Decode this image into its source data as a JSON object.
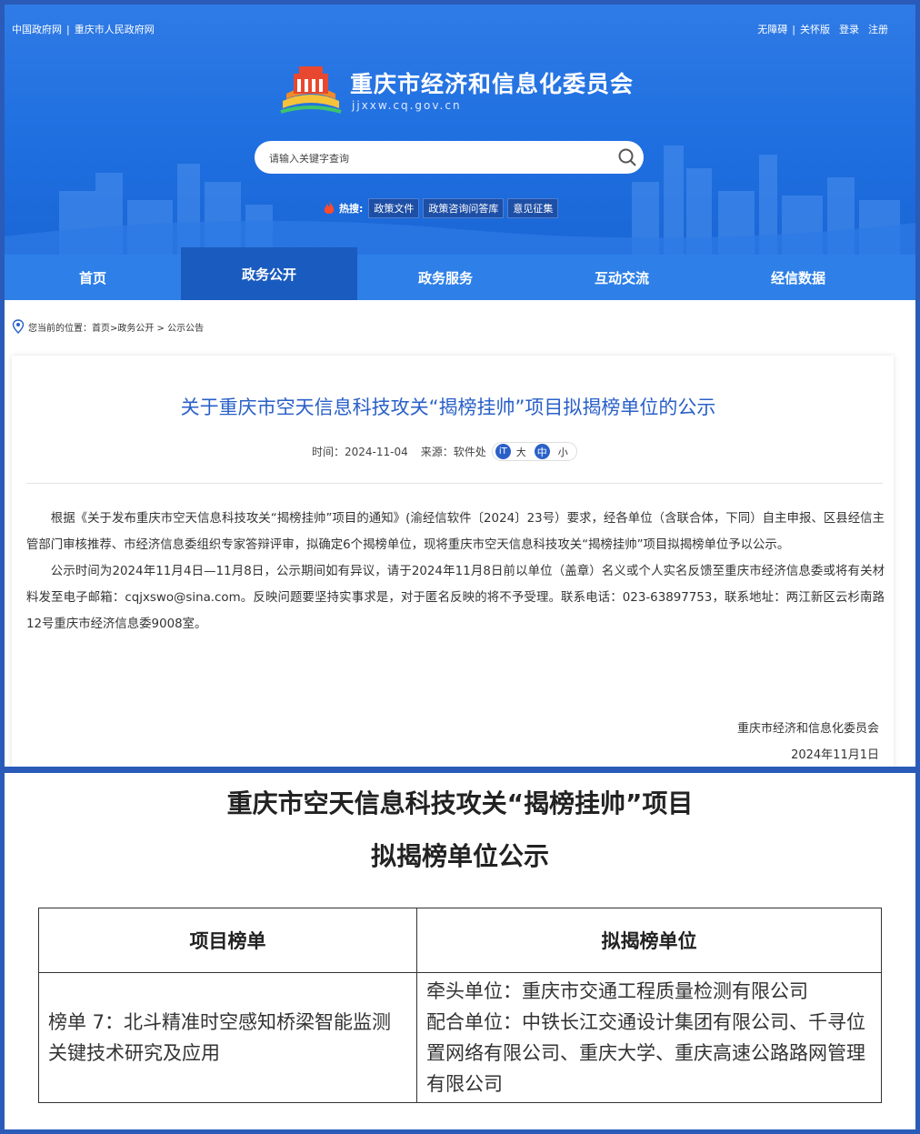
{
  "header": {
    "top_left_links": [
      "中国政府网",
      "重庆市人民政府网"
    ],
    "top_right_links": [
      "无障碍",
      "关怀版",
      "登录",
      "注册"
    ],
    "site_title": "重庆市经济和信息化委员会",
    "site_domain": "jjxxw.cq.gov.cn",
    "search_placeholder": "请输入关键字查询",
    "hot_label": "热搜:",
    "hot_tags": [
      "政策文件",
      "政策咨询问答库",
      "意见征集"
    ]
  },
  "nav": [
    "首页",
    "政务公开",
    "政务服务",
    "互动交流",
    "经信数据"
  ],
  "breadcrumb": "您当前的位置：首页>政务公开 > 公示公告",
  "article": {
    "title": "关于重庆市空天信息科技攻关“揭榜挂帅”项目拟揭榜单位的公示",
    "time_label": "时间：",
    "time": "2024-11-04",
    "source_label": "来源：",
    "source": "软件处",
    "font_size_icon": "iT",
    "font_sizes": [
      "大",
      "中",
      "小"
    ],
    "paragraphs": [
      "根据《关于发布重庆市空天信息科技攻关“揭榜挂帅”项目的通知》(渝经信软件〔2024〕23号）要求，经各单位（含联合体，下同）自主申报、区县经信主管部门审核推荐、市经济信息委组织专家答辩评审，拟确定6个揭榜单位，现将重庆市空天信息科技攻关“揭榜挂帅”项目拟揭榜单位予以公示。",
      "公示时间为2024年11月4日—11月8日，公示期间如有异议，请于2024年11月8日前以单位（盖章）名义或个人实名反馈至重庆市经济信息委或将有关材料发至电子邮箱：cqjxswo@sina.com。反映问题要坚持实事求是，对于匿名反映的将不予受理。联系电话：023-63897753，联系地址：两江新区云杉南路12号重庆市经济信息委9008室。"
    ],
    "signature": "重庆市经济和信息化委员会",
    "sign_date": "2024年11月1日"
  },
  "document": {
    "title_line1": "重庆市空天信息科技攻关“揭榜挂帅”项目",
    "title_line2": "拟揭榜单位公示",
    "columns": [
      "项目榜单",
      "拟揭榜单位"
    ],
    "row": {
      "project": "榜单 7：北斗精准时空感知桥梁智能监测关键技术研究及应用",
      "lead_unit": "牵头单位：重庆市交通工程质量检测有限公司",
      "partner_units": "配合单位：中铁长江交通设计集团有限公司、千寻位置网络有限公司、重庆大学、重庆高速公路路网管理有限公司"
    }
  },
  "colors": {
    "header_blue": "#1f6fe0",
    "nav_active": "#1a5bbf",
    "title_blue": "#2a60c8",
    "frame": "#2a5bb8"
  }
}
